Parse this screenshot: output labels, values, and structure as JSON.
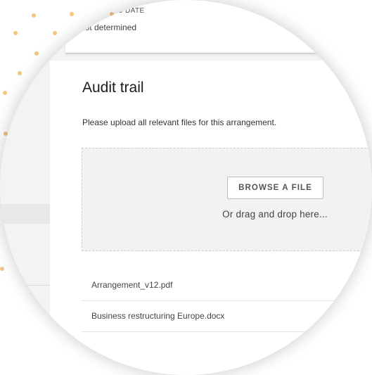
{
  "reporting": {
    "label": "REPORTING DATE",
    "value": "Not determined"
  },
  "audit": {
    "title": "Audit trail",
    "instruction": "Please upload all relevant files for this arrangement.",
    "browse_label": "BROWSE A FILE",
    "drag_text": "Or drag and drop here..."
  },
  "files": [
    {
      "name": "Arrangement_v12.pdf"
    },
    {
      "name": "Business restructuring Europe.docx"
    }
  ],
  "colors": {
    "decor_dots": "#f4c67f",
    "shadow": "#d0d0d0"
  }
}
